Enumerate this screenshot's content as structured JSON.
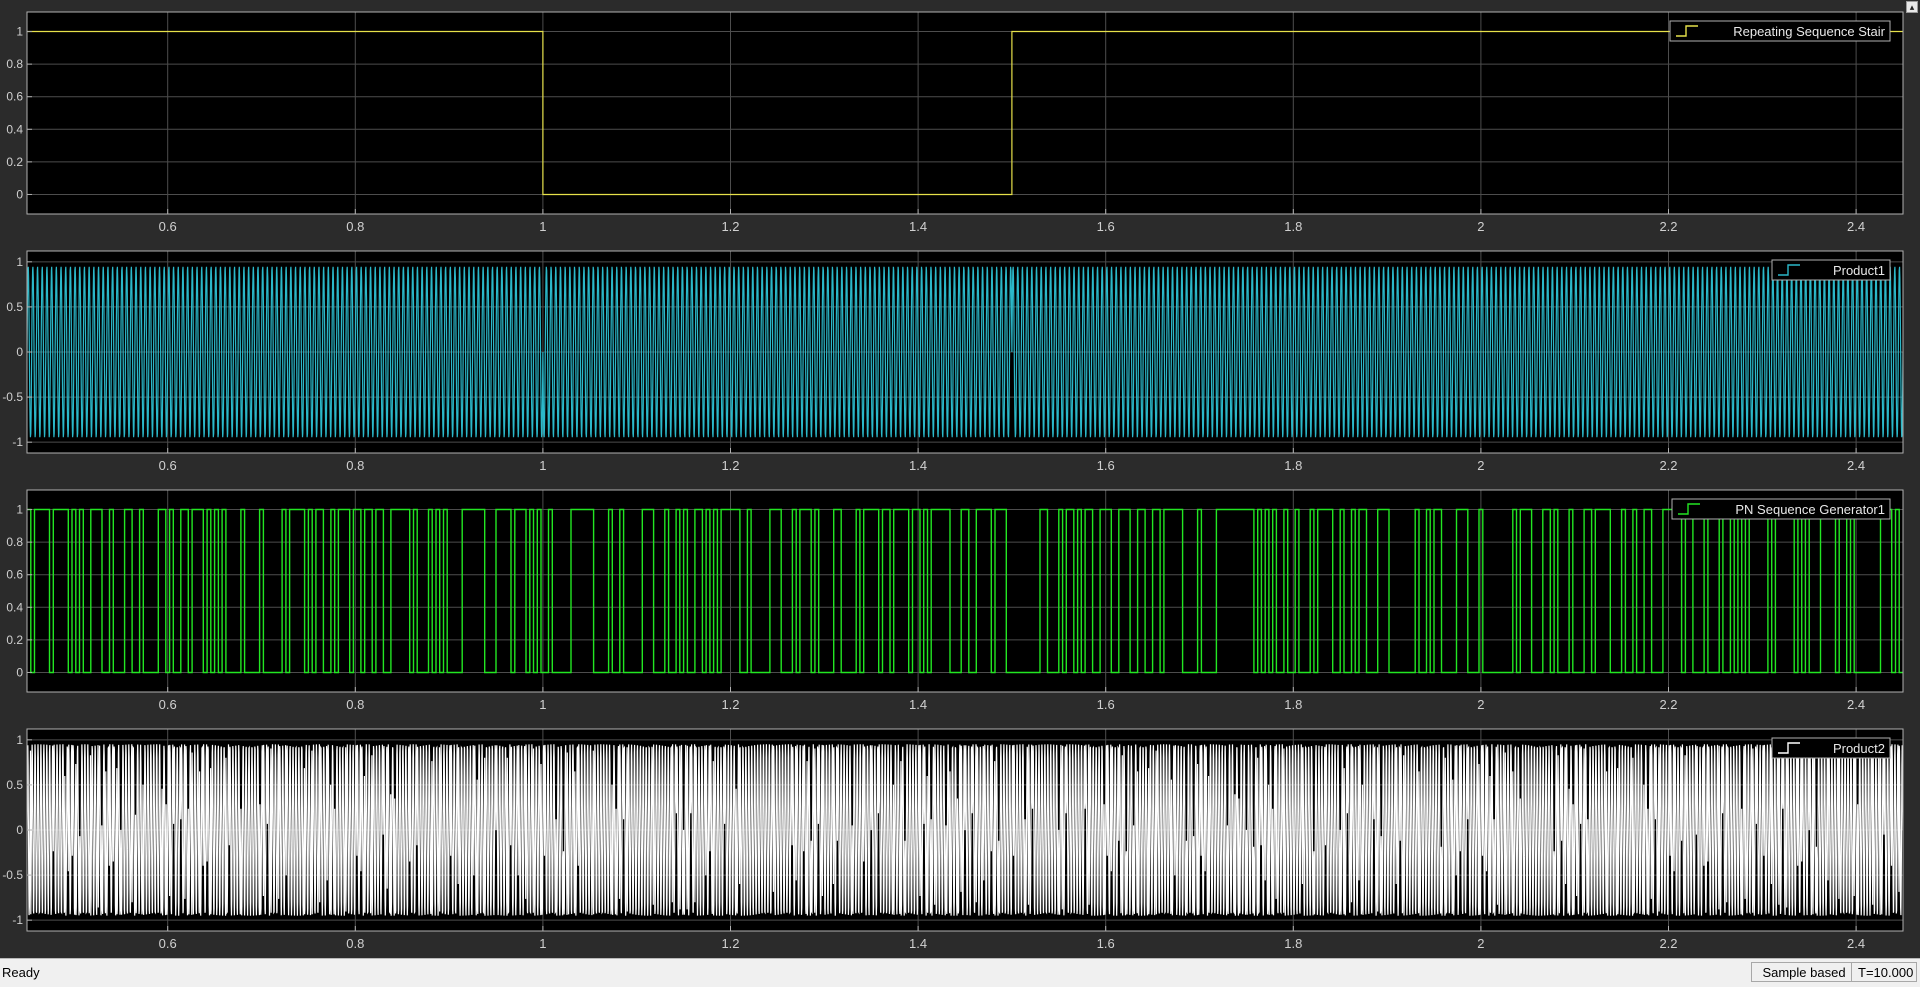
{
  "window": {
    "corner_glyph": "▴"
  },
  "status": {
    "text": "Ready",
    "mode": "Sample based",
    "time": "T=10.000"
  },
  "colors": {
    "background": "#2b2b2b",
    "axes_bg": "#000000",
    "grid": "#4d4d4d",
    "axis_line": "#b0b0b0",
    "tick_label": "#d0d0d0"
  },
  "chart_data": [
    {
      "type": "line",
      "step": true,
      "series": [
        {
          "name": "Repeating Sequence Stair",
          "color": "#e6e14a",
          "x": [
            0.45,
            1.0,
            1.0,
            1.5,
            1.5,
            2.45
          ],
          "y": [
            1,
            1,
            0,
            0,
            1,
            1
          ]
        }
      ],
      "xlim": [
        0.45,
        2.45
      ],
      "ylim": [
        -0.12,
        1.12
      ],
      "xticks": [
        0.6,
        0.8,
        1,
        1.2,
        1.4,
        1.6,
        1.8,
        2,
        2.2,
        2.4
      ],
      "xticklabels": [
        "0.6",
        "0.8",
        "1",
        "1.2",
        "1.4",
        "1.6",
        "1.8",
        "2",
        "2.2",
        "2.4"
      ],
      "yticks": [
        0,
        0.2,
        0.4,
        0.6,
        0.8,
        1
      ],
      "yticklabels": [
        "0",
        "0.2",
        "0.4",
        "0.6",
        "0.8",
        "1"
      ],
      "grid": true,
      "legend": "top-right"
    },
    {
      "type": "line",
      "series": [
        {
          "name": "Product1",
          "color": "#2bb8c9",
          "kind": "sine",
          "amplitude": 0.95,
          "frequency": 200,
          "phase_flip_at": [
            1.0,
            1.5
          ]
        }
      ],
      "xlim": [
        0.45,
        2.45
      ],
      "ylim": [
        -1.12,
        1.12
      ],
      "xticks": [
        0.6,
        0.8,
        1,
        1.2,
        1.4,
        1.6,
        1.8,
        2,
        2.2,
        2.4
      ],
      "xticklabels": [
        "0.6",
        "0.8",
        "1",
        "1.2",
        "1.4",
        "1.6",
        "1.8",
        "2",
        "2.2",
        "2.4"
      ],
      "yticks": [
        -1,
        -0.5,
        0,
        0.5,
        1
      ],
      "yticklabels": [
        "-1",
        "-0.5",
        "0",
        "0.5",
        "1"
      ],
      "grid": true,
      "legend": "top-right"
    },
    {
      "type": "line",
      "step": true,
      "series": [
        {
          "name": "PN Sequence Generator1",
          "color": "#22e622",
          "kind": "binary_sequence",
          "bit_period": 0.004,
          "levels": [
            0,
            1
          ]
        }
      ],
      "xlim": [
        0.45,
        2.45
      ],
      "ylim": [
        -0.12,
        1.12
      ],
      "xticks": [
        0.6,
        0.8,
        1,
        1.2,
        1.4,
        1.6,
        1.8,
        2,
        2.2,
        2.4
      ],
      "xticklabels": [
        "0.6",
        "0.8",
        "1",
        "1.2",
        "1.4",
        "1.6",
        "1.8",
        "2",
        "2.2",
        "2.4"
      ],
      "yticks": [
        0,
        0.2,
        0.4,
        0.6,
        0.8,
        1
      ],
      "yticklabels": [
        "0",
        "0.2",
        "0.4",
        "0.6",
        "0.8",
        "1"
      ],
      "grid": true,
      "legend": "top-right"
    },
    {
      "type": "line",
      "series": [
        {
          "name": "Product2",
          "color": "#ffffff",
          "kind": "keyed_sine",
          "amplitude": 0.95,
          "frequency": 200,
          "bit_period": 0.004
        }
      ],
      "xlim": [
        0.45,
        2.45
      ],
      "ylim": [
        -1.12,
        1.12
      ],
      "xticks": [
        0.6,
        0.8,
        1,
        1.2,
        1.4,
        1.6,
        1.8,
        2,
        2.2,
        2.4
      ],
      "xticklabels": [
        "0.6",
        "0.8",
        "1",
        "1.2",
        "1.4",
        "1.6",
        "1.8",
        "2",
        "2.2",
        "2.4"
      ],
      "yticks": [
        -1,
        -0.5,
        0,
        0.5,
        1
      ],
      "yticklabels": [
        "-1",
        "-0.5",
        "0",
        "0.5",
        "1"
      ],
      "grid": true,
      "legend": "top-right"
    }
  ]
}
